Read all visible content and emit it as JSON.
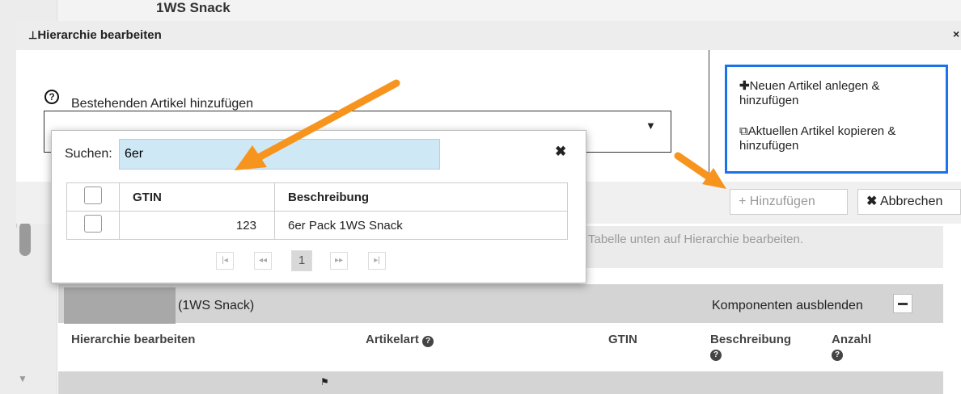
{
  "background": {
    "title": "1WS Snack",
    "hint_text": "Tabelle unten auf Hierarchie bearbeiten.",
    "component_name": "(1WS Snack)",
    "hide_components_label": "Komponenten ausblenden",
    "columns": [
      "Hierarchie bearbeiten",
      "Artikelart",
      "GTIN",
      "Beschreibung",
      "Anzahl"
    ]
  },
  "dialog": {
    "title": "Hierarchie bearbeiten",
    "existing_label": "Bestehenden Artikel hinzufügen",
    "options": {
      "new_article": "Neuen Artikel anlegen & hinzufügen",
      "copy_article": "Aktuellen Artikel kopieren & hinzufügen"
    },
    "buttons": {
      "add": "Hinzufügen",
      "cancel": "Abbrechen"
    }
  },
  "search_popup": {
    "label": "Suchen:",
    "value": "6er",
    "columns": [
      "GTIN",
      "Beschreibung"
    ],
    "rows": [
      {
        "gtin": "123",
        "description": "6er Pack 1WS Snack"
      }
    ],
    "current_page": "1"
  },
  "colors": {
    "highlight_border": "#1a73e8",
    "annotation_arrow": "#f7941d",
    "search_field": "#cfe8f5"
  }
}
